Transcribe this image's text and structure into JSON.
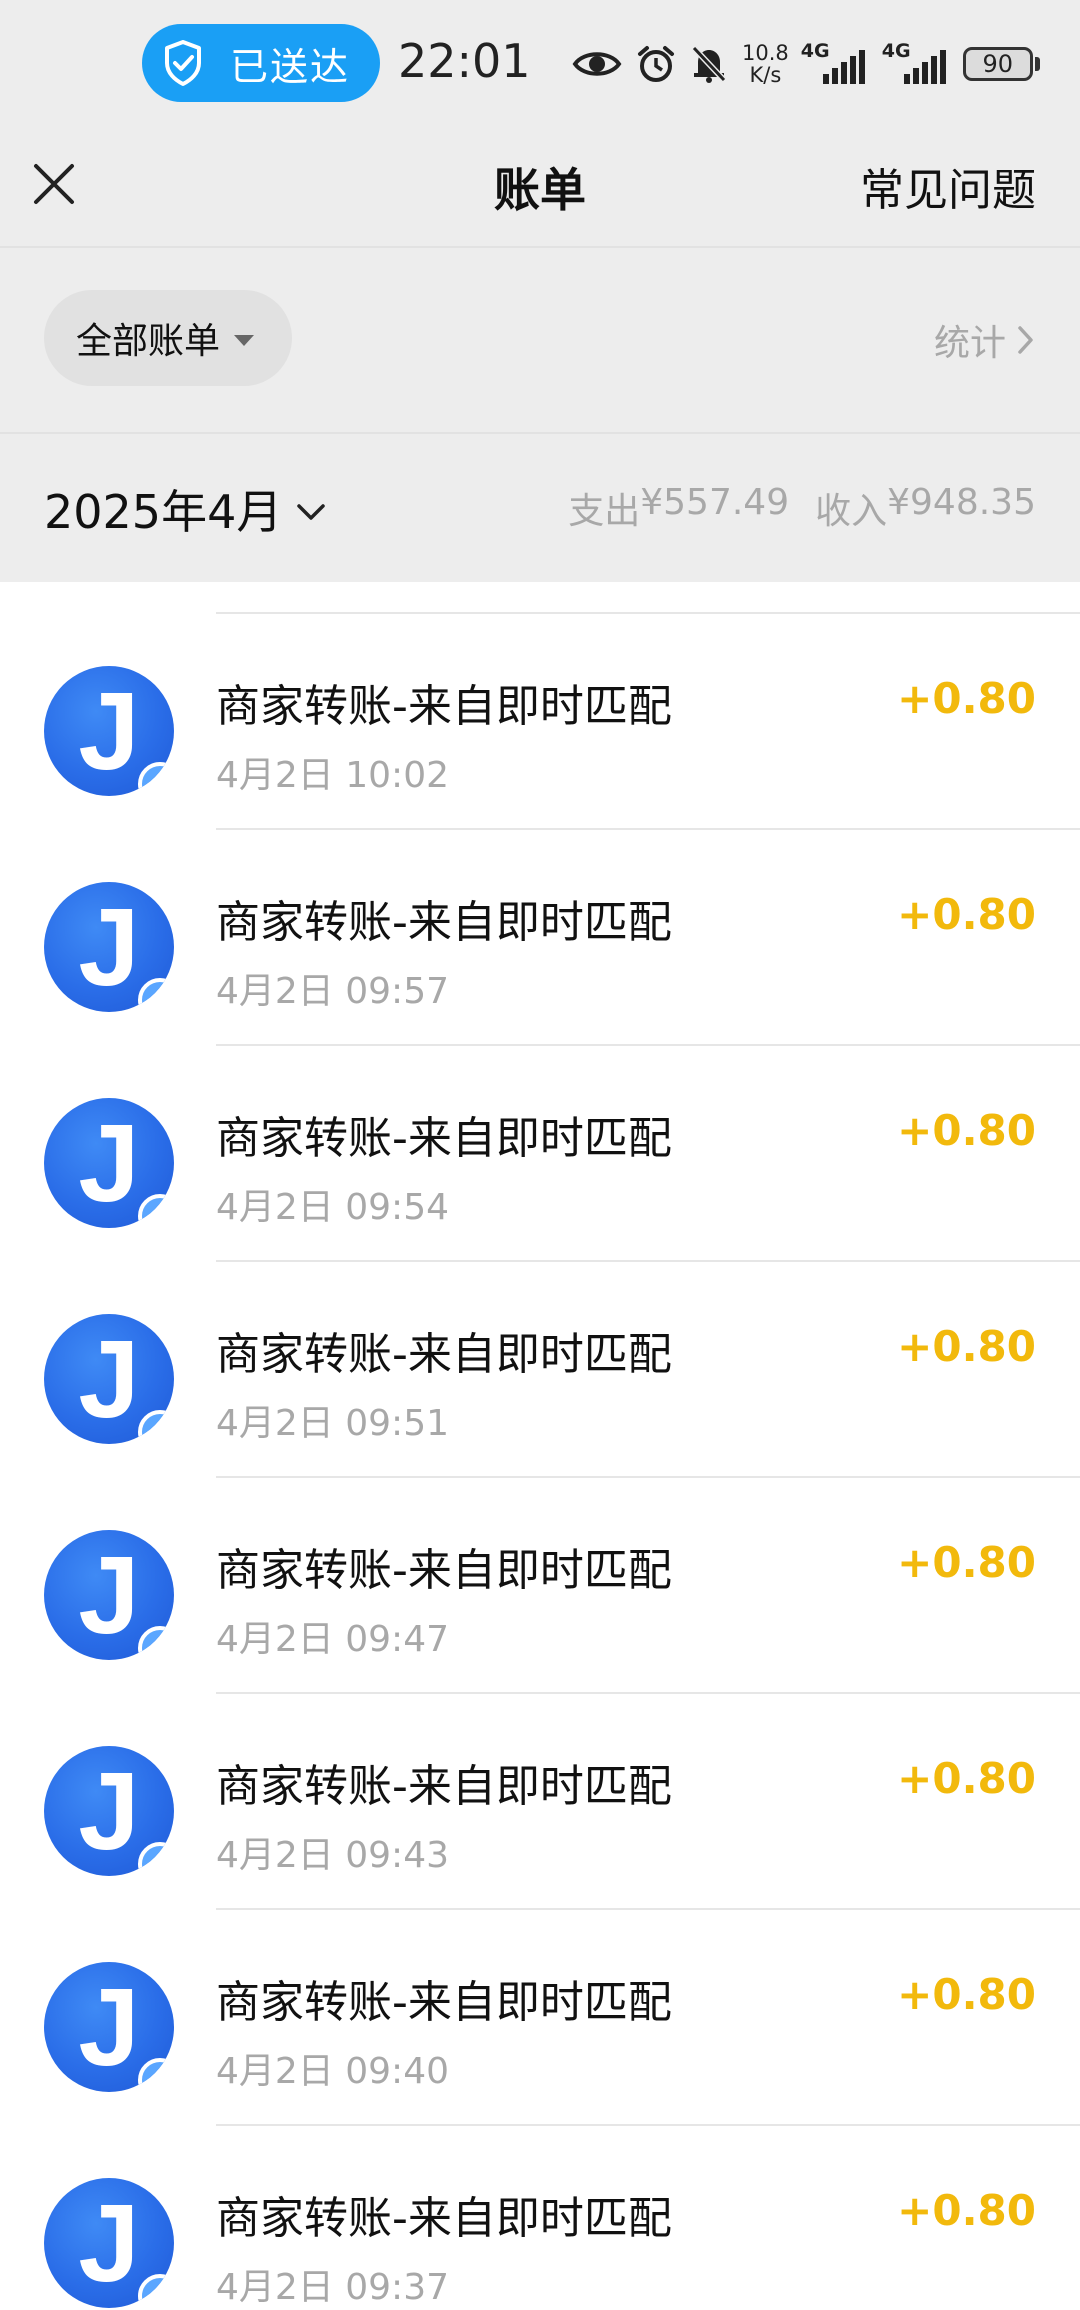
{
  "status_bar": {
    "delivered_label": "已送达",
    "time": "22:01",
    "net_speed_value": "10.8",
    "net_speed_unit": "K/s",
    "network_1": "4G",
    "network_2": "4G",
    "battery": "90",
    "icons": [
      "eye-icon",
      "alarm-icon",
      "bell-off-icon",
      "signal-icon",
      "signal-icon",
      "battery-icon"
    ]
  },
  "header": {
    "title": "账单",
    "faq_label": "常见问题",
    "close_icon": "close-icon"
  },
  "filter": {
    "all_bills_label": "全部账单",
    "stats_label": "统计"
  },
  "month": {
    "label": "2025年4月",
    "expense_label": "支出",
    "expense_value": "¥557.49",
    "income_label": "收入",
    "income_value": "¥948.35"
  },
  "colors": {
    "accent_amount": "#f2b90c",
    "avatar_blue": "#2a6de8",
    "delivered_pill": "#1a9ff5"
  },
  "transactions": [
    {
      "name": "商家转账-来自即时匹配",
      "time": "4月2日 10:02",
      "amount": "+0.80",
      "avatar_letter": "J"
    },
    {
      "name": "商家转账-来自即时匹配",
      "time": "4月2日 09:57",
      "amount": "+0.80",
      "avatar_letter": "J"
    },
    {
      "name": "商家转账-来自即时匹配",
      "time": "4月2日 09:54",
      "amount": "+0.80",
      "avatar_letter": "J"
    },
    {
      "name": "商家转账-来自即时匹配",
      "time": "4月2日 09:51",
      "amount": "+0.80",
      "avatar_letter": "J"
    },
    {
      "name": "商家转账-来自即时匹配",
      "time": "4月2日 09:47",
      "amount": "+0.80",
      "avatar_letter": "J"
    },
    {
      "name": "商家转账-来自即时匹配",
      "time": "4月2日 09:43",
      "amount": "+0.80",
      "avatar_letter": "J"
    },
    {
      "name": "商家转账-来自即时匹配",
      "time": "4月2日 09:40",
      "amount": "+0.80",
      "avatar_letter": "J"
    },
    {
      "name": "商家转账-来自即时匹配",
      "time": "4月2日 09:37",
      "amount": "+0.80",
      "avatar_letter": "J"
    }
  ]
}
